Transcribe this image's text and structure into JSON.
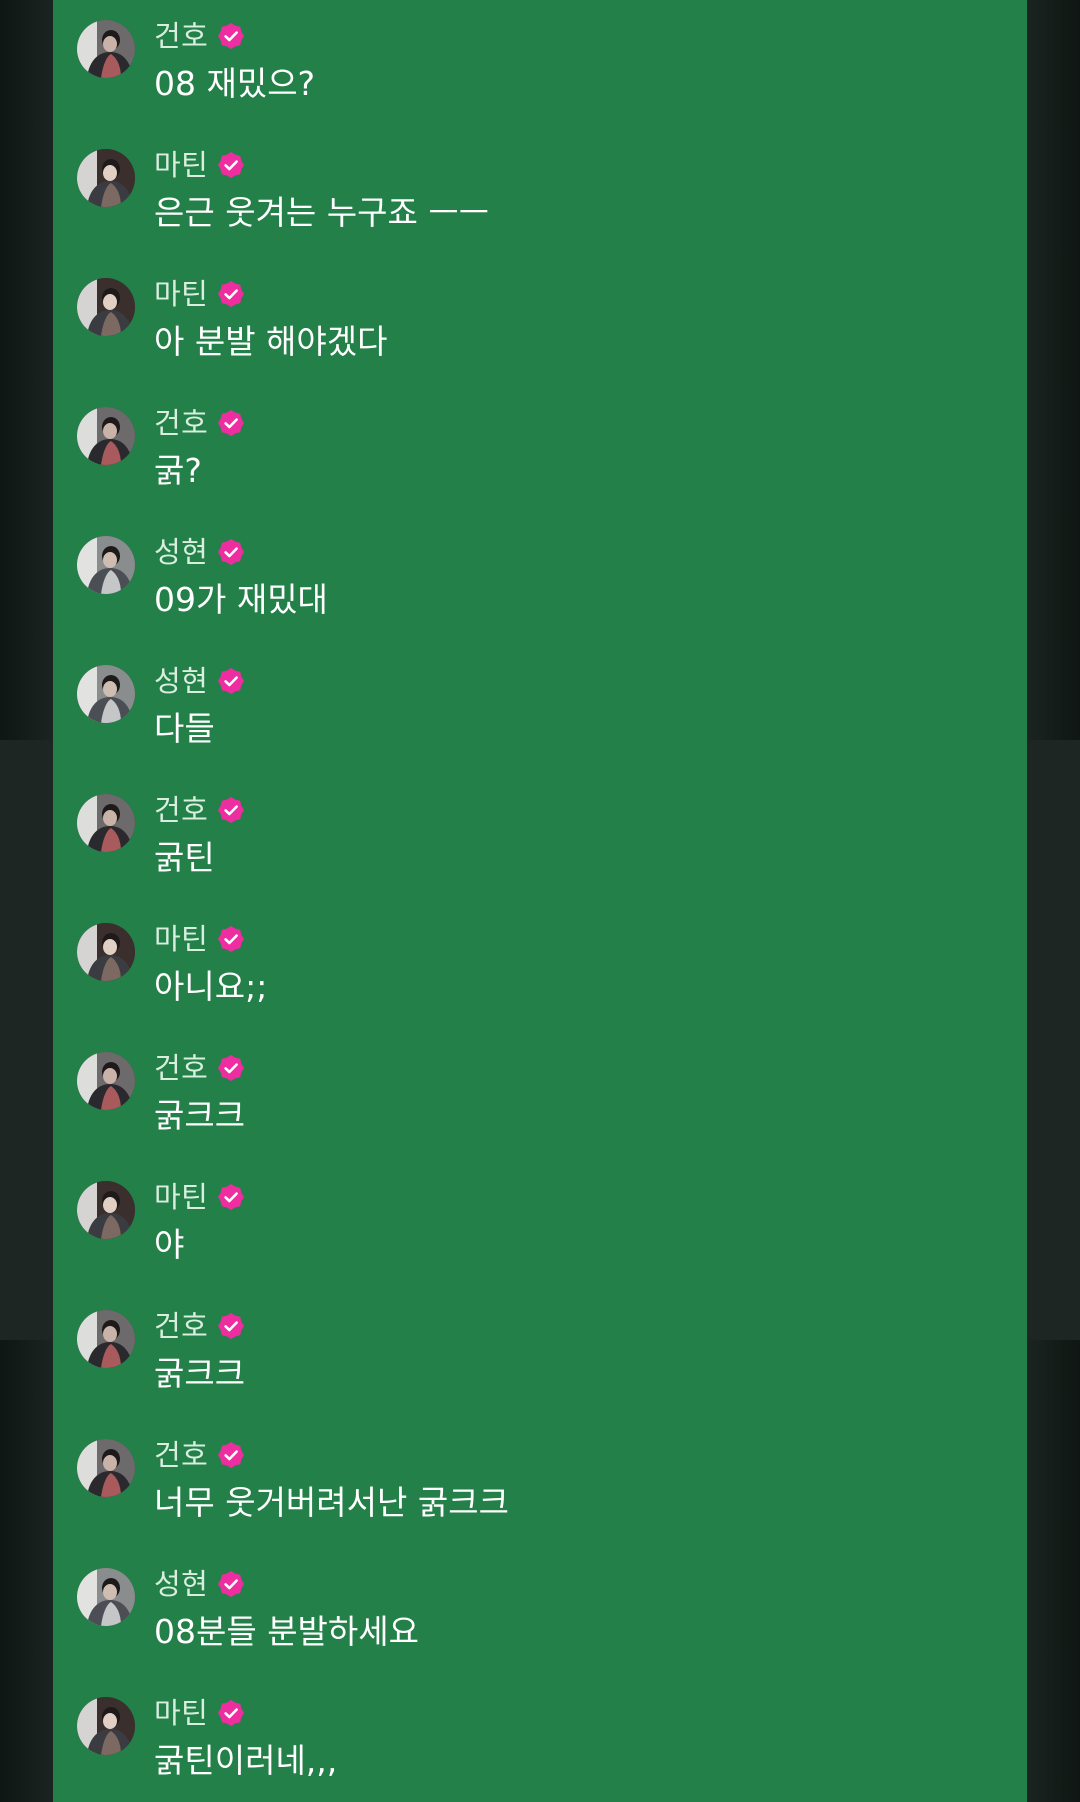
{
  "colors": {
    "panel_bg": "#228048",
    "badge": "#ee2da0",
    "name_text": "#d9eedf",
    "message_text": "#ffffff"
  },
  "icons": {
    "verified": "verified-badge-icon"
  },
  "messages": [
    {
      "sender": "건호",
      "avatar": "avatar-건호",
      "text": "08 재밌으?"
    },
    {
      "sender": "마틴",
      "avatar": "avatar-마틴",
      "text": "은근 웃겨는 누구죠 ㅡㅡ"
    },
    {
      "sender": "마틴",
      "avatar": "avatar-마틴",
      "text": "아 분발 해야겠다"
    },
    {
      "sender": "건호",
      "avatar": "avatar-건호",
      "text": "굵?"
    },
    {
      "sender": "성현",
      "avatar": "avatar-성현",
      "text": "09가 재밌대"
    },
    {
      "sender": "성현",
      "avatar": "avatar-성현",
      "text": "다들"
    },
    {
      "sender": "건호",
      "avatar": "avatar-건호",
      "text": "굵틴"
    },
    {
      "sender": "마틴",
      "avatar": "avatar-마틴",
      "text": "아니요;;"
    },
    {
      "sender": "건호",
      "avatar": "avatar-건호",
      "text": "굵크크"
    },
    {
      "sender": "마틴",
      "avatar": "avatar-마틴",
      "text": "야"
    },
    {
      "sender": "건호",
      "avatar": "avatar-건호",
      "text": "굵크크"
    },
    {
      "sender": "건호",
      "avatar": "avatar-건호",
      "text": "너무 웃거버려서난 굵크크"
    },
    {
      "sender": "성현",
      "avatar": "avatar-성현",
      "text": "08분들 분발하세요"
    },
    {
      "sender": "마틴",
      "avatar": "avatar-마틴",
      "text": "굵틴이러네,,,"
    }
  ]
}
